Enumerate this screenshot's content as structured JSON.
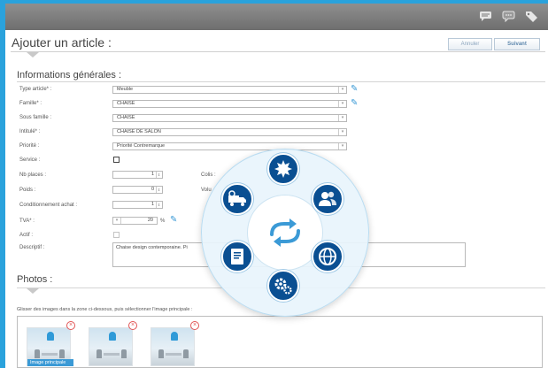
{
  "page": {
    "title": "Ajouter un article :",
    "buttons": {
      "cancel": "Annuler",
      "next": "Suivant"
    }
  },
  "general": {
    "title": "Informations générales :",
    "type_label": "Type article* :",
    "type_value": "Meuble",
    "famille_label": "Famille* :",
    "famille_value": "CHAISE",
    "sous_famille_label": "Sous famille :",
    "sous_famille_value": "CHAISE",
    "intitule_label": "Intitulé* :",
    "intitule_value": "CHAISE DE SALON",
    "priorite_label": "Priorité :",
    "priorite_value": "Priorité Contremarque",
    "service_label": "Service :",
    "nb_places_label": "Nb places :",
    "nb_places_value": "1",
    "colis_label": "Colis :",
    "poids_label": "Poids :",
    "poids_value": "0",
    "volume_label": "Volu",
    "conditionnement_label": "Conditionnement achat :",
    "conditionnement_value": "1",
    "tva_label": "TVA* :",
    "tva_value": "20",
    "tva_unit": "%",
    "actif_label": "Actif :",
    "descriptif_label": "Descriptif :",
    "descriptif_value": "Chaise design contemporaine. Pi"
  },
  "photos": {
    "title": "Photos :",
    "hint": "Glisser des images dans la zone ci-dessous, puis sélectionner l'image principale :",
    "main_label": "Image principale"
  },
  "radial_menu": {
    "center_icon": "refresh-icon",
    "items": [
      "leaf-icon",
      "users-icon",
      "globe-icon",
      "gears-icon",
      "document-icon",
      "delivery-truck-icon"
    ]
  },
  "topbar": {
    "icons": [
      "chat-icon",
      "comments-icon",
      "tags-icon"
    ]
  },
  "colors": {
    "accent": "#2aa2dc",
    "menu_orb": "#0a4f92"
  }
}
